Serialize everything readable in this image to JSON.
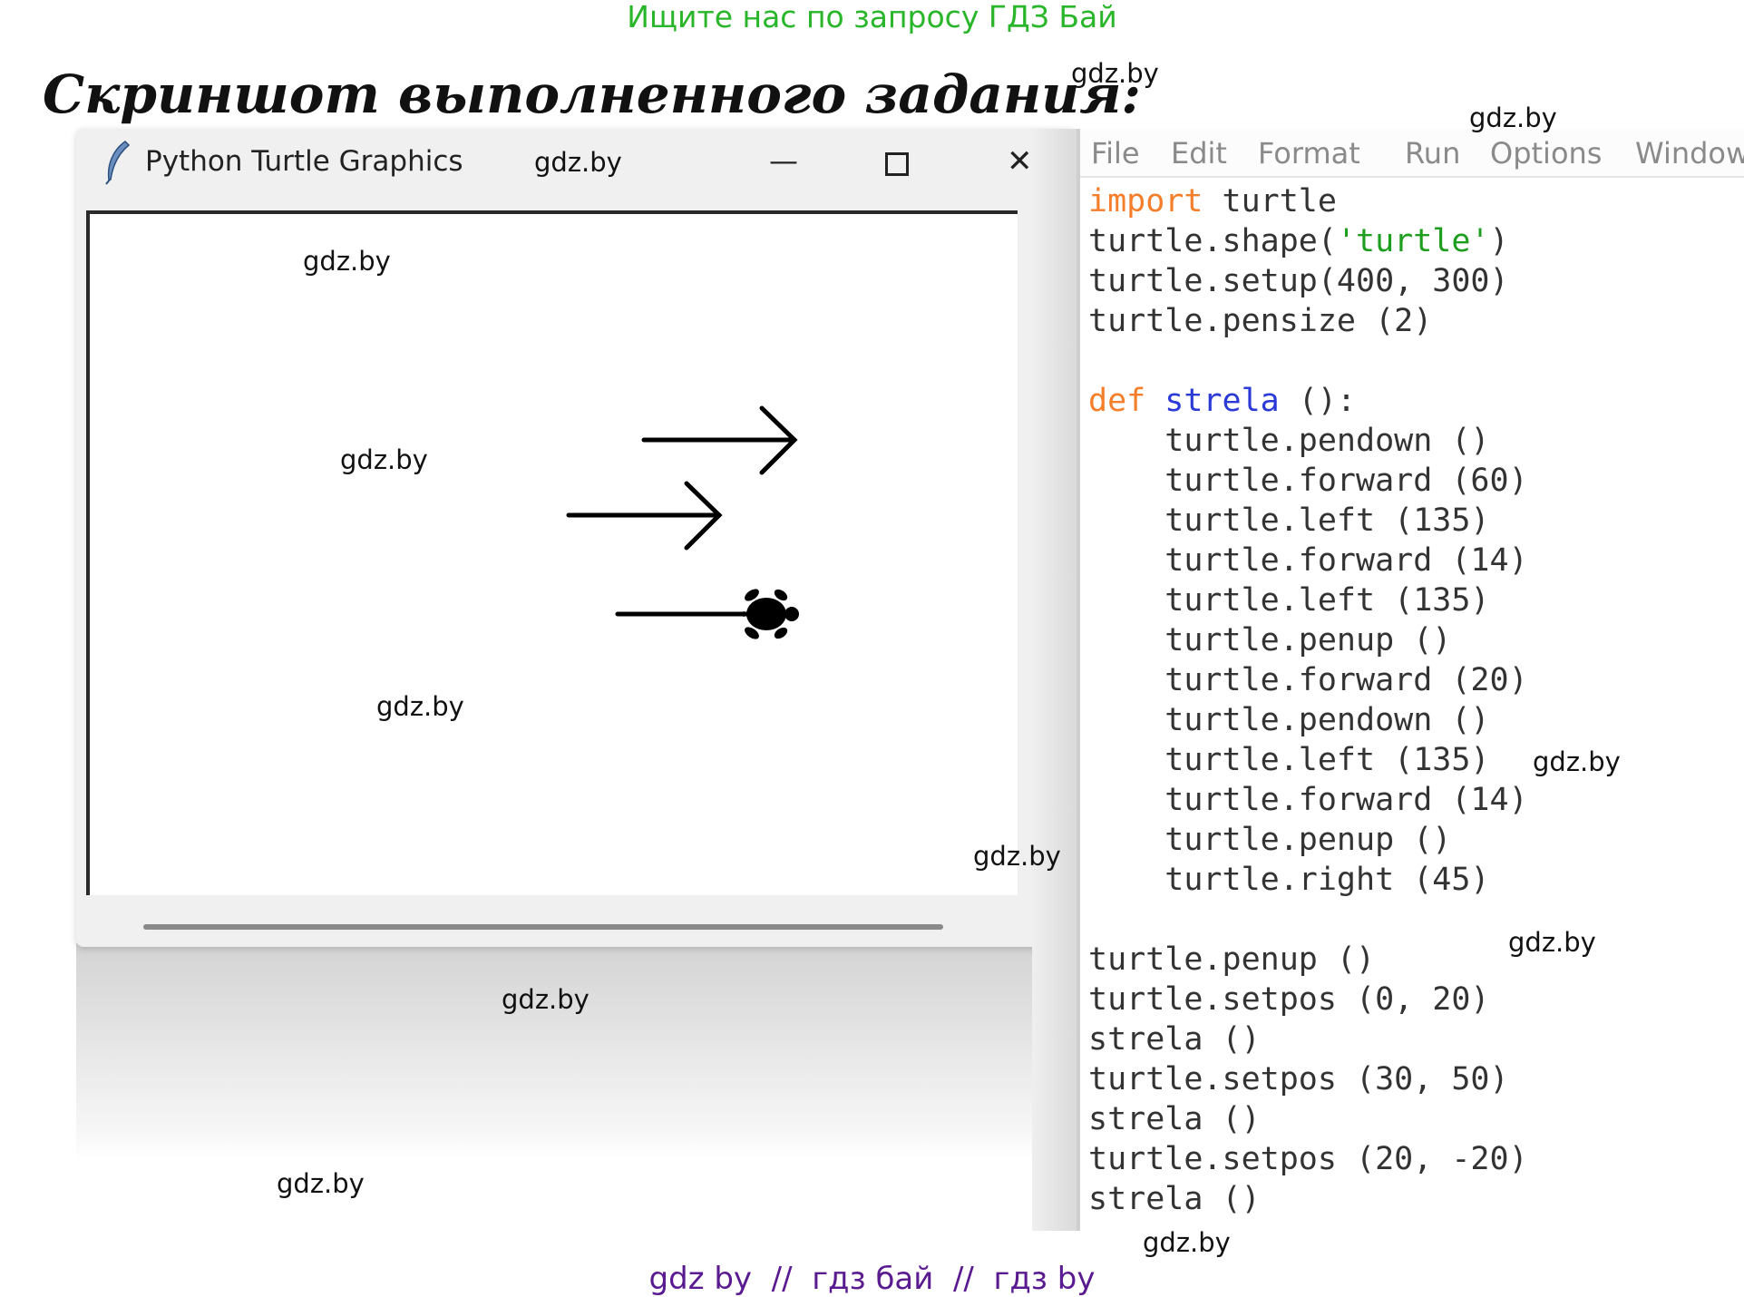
{
  "top_banner": "Ищите нас по запросу ГДЗ Бай",
  "heading": "Скриншот выполненного задания:",
  "watermark": "gdz.by",
  "turtle_window": {
    "title": "Python Turtle Graphics",
    "minimize_glyph": "—",
    "maximize_glyph": "☐",
    "close_glyph": "✕",
    "icon": "feather-icon"
  },
  "idle": {
    "menu": [
      "File",
      "Edit",
      "Format",
      "Run",
      "Options",
      "Window"
    ],
    "code_lines": [
      [
        {
          "t": "import",
          "c": "kw"
        },
        {
          "t": " turtle"
        }
      ],
      [
        {
          "t": "turtle.shape("
        },
        {
          "t": "'turtle'",
          "c": "str"
        },
        {
          "t": ")"
        }
      ],
      [
        {
          "t": "turtle.setup(400, 300)"
        }
      ],
      [
        {
          "t": "turtle.pensize (2)"
        }
      ],
      [
        {
          "t": ""
        }
      ],
      [
        {
          "t": "def",
          "c": "kw"
        },
        {
          "t": " "
        },
        {
          "t": "strela",
          "c": "fn"
        },
        {
          "t": " ():"
        }
      ],
      [
        {
          "t": "    turtle.pendown ()"
        }
      ],
      [
        {
          "t": "    turtle.forward (60)"
        }
      ],
      [
        {
          "t": "    turtle.left (135)"
        }
      ],
      [
        {
          "t": "    turtle.forward (14)"
        }
      ],
      [
        {
          "t": "    turtle.left (135)"
        }
      ],
      [
        {
          "t": "    turtle.penup ()"
        }
      ],
      [
        {
          "t": "    turtle.forward (20)"
        }
      ],
      [
        {
          "t": "    turtle.pendown ()"
        }
      ],
      [
        {
          "t": "    turtle.left (135)"
        }
      ],
      [
        {
          "t": "    turtle.forward (14)"
        }
      ],
      [
        {
          "t": "    turtle.penup ()"
        }
      ],
      [
        {
          "t": "    turtle.right (45)"
        }
      ],
      [
        {
          "t": ""
        }
      ],
      [
        {
          "t": "turtle.penup ()"
        }
      ],
      [
        {
          "t": "turtle.setpos (0, 20)"
        }
      ],
      [
        {
          "t": "strela ()"
        }
      ],
      [
        {
          "t": "turtle.setpos (30, 50)"
        }
      ],
      [
        {
          "t": "strela ()"
        }
      ],
      [
        {
          "t": "turtle.setpos (20, -20)"
        }
      ],
      [
        {
          "t": "strela ()"
        }
      ]
    ]
  },
  "bottom_banner": "gdz by  //  гдз бай  //  гдз by",
  "colors": {
    "banner_green": "#2ab62a",
    "banner_purple": "#5a1a90",
    "keyword": "#f57e2b",
    "function_name": "#2b3ad6",
    "string": "#1e9e1e"
  }
}
